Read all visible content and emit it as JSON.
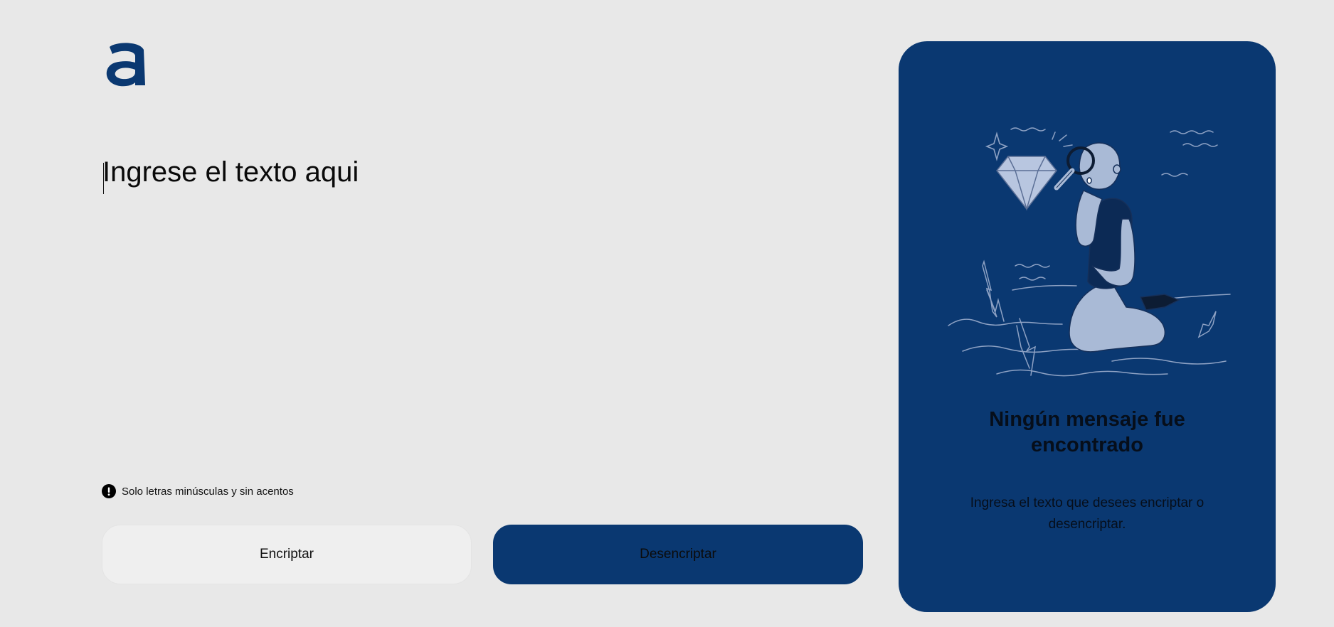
{
  "logo": {
    "icon": "alura-a-logo",
    "color": "#0a3871"
  },
  "input": {
    "placeholder": "Ingrese el texto aqui",
    "value": ""
  },
  "hint": {
    "icon": "exclamation-circle-icon",
    "text": "Solo letras minúsculas y sin acentos"
  },
  "buttons": {
    "encrypt_label": "Encriptar",
    "decrypt_label": "Desencriptar"
  },
  "output_panel": {
    "illustration": "person-with-magnifying-glass-illustration",
    "title": "Ningún mensaje fue encontrado",
    "description": "Ingresa el texto que desees encriptar o desencriptar."
  },
  "colors": {
    "background": "#e8e8e8",
    "accent": "#0a3871",
    "light_button": "#efefef"
  }
}
